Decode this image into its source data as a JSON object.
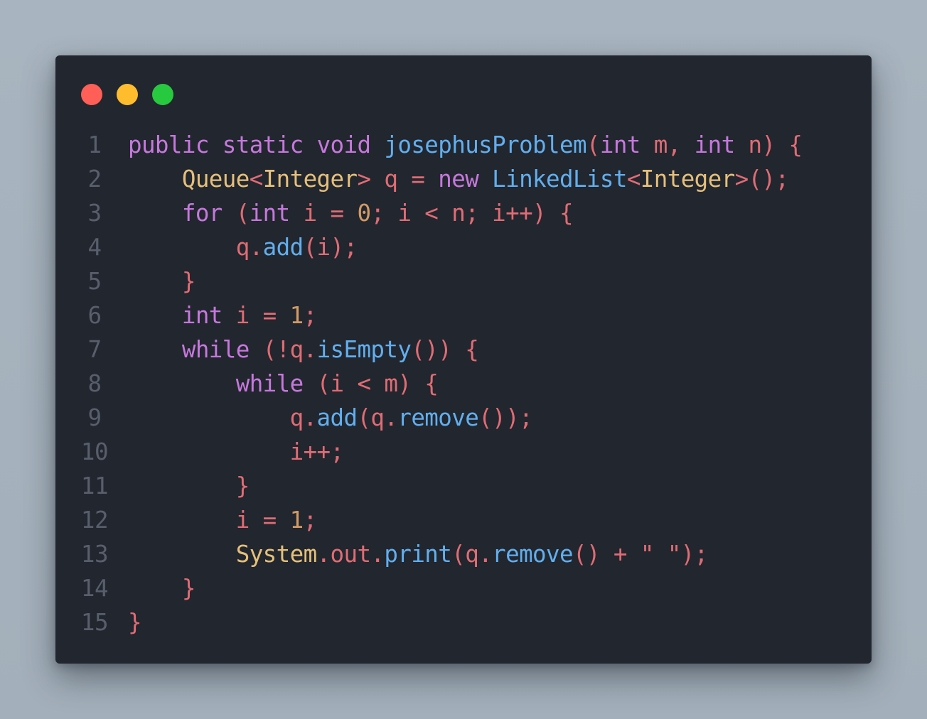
{
  "window": {
    "controls": [
      {
        "name": "close",
        "color": "#ff5f56"
      },
      {
        "name": "minimize",
        "color": "#ffbd2e"
      },
      {
        "name": "maximize",
        "color": "#27c93f"
      }
    ]
  },
  "palette": {
    "keyword": "#c678dd",
    "type": "#e5c07b",
    "function": "#61afef",
    "number": "#d19a66",
    "plain": "#e06c75",
    "line_number": "#585e6b",
    "background": "#22262e"
  },
  "code": {
    "language": "java",
    "lines": [
      {
        "num": "1",
        "tokens": [
          {
            "t": "public",
            "c": "kw"
          },
          {
            "t": " ",
            "c": "pl"
          },
          {
            "t": "static",
            "c": "kw"
          },
          {
            "t": " ",
            "c": "pl"
          },
          {
            "t": "void",
            "c": "kw"
          },
          {
            "t": " ",
            "c": "pl"
          },
          {
            "t": "josephusProblem",
            "c": "fn"
          },
          {
            "t": "(",
            "c": "pl"
          },
          {
            "t": "int",
            "c": "kw"
          },
          {
            "t": " m, ",
            "c": "pl"
          },
          {
            "t": "int",
            "c": "kw"
          },
          {
            "t": " n) {",
            "c": "pl"
          }
        ]
      },
      {
        "num": "2",
        "tokens": [
          {
            "t": "    ",
            "c": "pl"
          },
          {
            "t": "Queue",
            "c": "ty"
          },
          {
            "t": "<",
            "c": "pl"
          },
          {
            "t": "Integer",
            "c": "ty"
          },
          {
            "t": "> q = ",
            "c": "pl"
          },
          {
            "t": "new",
            "c": "kw"
          },
          {
            "t": " ",
            "c": "pl"
          },
          {
            "t": "LinkedList",
            "c": "fn"
          },
          {
            "t": "<",
            "c": "pl"
          },
          {
            "t": "Integer",
            "c": "ty"
          },
          {
            "t": ">();",
            "c": "pl"
          }
        ]
      },
      {
        "num": "3",
        "tokens": [
          {
            "t": "    ",
            "c": "pl"
          },
          {
            "t": "for",
            "c": "kw"
          },
          {
            "t": " (",
            "c": "pl"
          },
          {
            "t": "int",
            "c": "kw"
          },
          {
            "t": " i = ",
            "c": "pl"
          },
          {
            "t": "0",
            "c": "nm"
          },
          {
            "t": "; i < n; i++) {",
            "c": "pl"
          }
        ]
      },
      {
        "num": "4",
        "tokens": [
          {
            "t": "        q.",
            "c": "pl"
          },
          {
            "t": "add",
            "c": "fn"
          },
          {
            "t": "(i);",
            "c": "pl"
          }
        ]
      },
      {
        "num": "5",
        "tokens": [
          {
            "t": "    }",
            "c": "pl"
          }
        ]
      },
      {
        "num": "6",
        "tokens": [
          {
            "t": "    ",
            "c": "pl"
          },
          {
            "t": "int",
            "c": "kw"
          },
          {
            "t": " i = ",
            "c": "pl"
          },
          {
            "t": "1",
            "c": "nm"
          },
          {
            "t": ";",
            "c": "pl"
          }
        ]
      },
      {
        "num": "7",
        "tokens": [
          {
            "t": "    ",
            "c": "pl"
          },
          {
            "t": "while",
            "c": "kw"
          },
          {
            "t": " (!q.",
            "c": "pl"
          },
          {
            "t": "isEmpty",
            "c": "fn"
          },
          {
            "t": "()) {",
            "c": "pl"
          }
        ]
      },
      {
        "num": "8",
        "tokens": [
          {
            "t": "        ",
            "c": "pl"
          },
          {
            "t": "while",
            "c": "kw"
          },
          {
            "t": " (i < m) {",
            "c": "pl"
          }
        ]
      },
      {
        "num": "9",
        "tokens": [
          {
            "t": "            q.",
            "c": "pl"
          },
          {
            "t": "add",
            "c": "fn"
          },
          {
            "t": "(q.",
            "c": "pl"
          },
          {
            "t": "remove",
            "c": "fn"
          },
          {
            "t": "());",
            "c": "pl"
          }
        ]
      },
      {
        "num": "10",
        "tokens": [
          {
            "t": "            i++;",
            "c": "pl"
          }
        ]
      },
      {
        "num": "11",
        "tokens": [
          {
            "t": "        }",
            "c": "pl"
          }
        ]
      },
      {
        "num": "12",
        "tokens": [
          {
            "t": "        i = ",
            "c": "pl"
          },
          {
            "t": "1",
            "c": "nm"
          },
          {
            "t": ";",
            "c": "pl"
          }
        ]
      },
      {
        "num": "13",
        "tokens": [
          {
            "t": "        ",
            "c": "pl"
          },
          {
            "t": "System",
            "c": "ty"
          },
          {
            "t": ".out.",
            "c": "pl"
          },
          {
            "t": "print",
            "c": "fn"
          },
          {
            "t": "(q.",
            "c": "pl"
          },
          {
            "t": "remove",
            "c": "fn"
          },
          {
            "t": "() + \" \");",
            "c": "pl"
          }
        ]
      },
      {
        "num": "14",
        "tokens": [
          {
            "t": "    }",
            "c": "pl"
          }
        ]
      },
      {
        "num": "15",
        "tokens": [
          {
            "t": "}",
            "c": "pl"
          }
        ]
      }
    ]
  }
}
